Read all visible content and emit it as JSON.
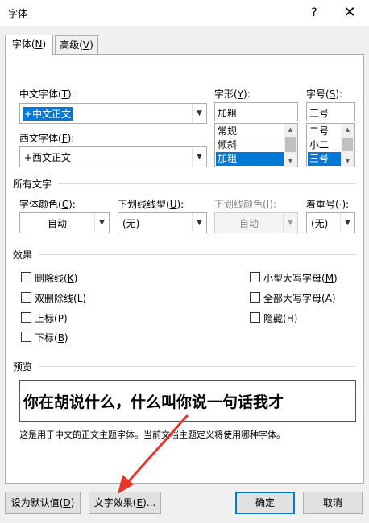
{
  "window": {
    "title": "字体",
    "help": "?",
    "close": "✕"
  },
  "tabs": [
    {
      "label": "字体(",
      "key": "N",
      "end": ")"
    },
    {
      "label": "高级(",
      "key": "V",
      "end": ")"
    }
  ],
  "chinese_font": {
    "label": "中文字体(",
    "key": "T",
    "end": "):",
    "value": "+中文正文"
  },
  "western_font": {
    "label": "西文字体(",
    "key": "F",
    "end": "):",
    "value": "+西文正文"
  },
  "font_style": {
    "label": "字形(",
    "key": "Y",
    "end": "):",
    "value": "加粗",
    "options": [
      "常规",
      "倾斜",
      "加粗"
    ],
    "selected_index": 2
  },
  "font_size": {
    "label": "字号(",
    "key": "S",
    "end": "):",
    "value": "三号",
    "options": [
      "二号",
      "小二",
      "三号"
    ],
    "selected_index": 2
  },
  "all_text": {
    "heading": "所有文字",
    "font_color": {
      "label": "字体颜色(",
      "key": "C",
      "end": "):",
      "value": "自动"
    },
    "underline_style": {
      "label": "下划线线型(",
      "key": "U",
      "end": "):",
      "value": "(无)"
    },
    "underline_color": {
      "label": "下划线颜色(I):",
      "value": "自动"
    },
    "emphasis": {
      "label": "着重号(·):",
      "value": "(无)"
    }
  },
  "effects": {
    "heading": "效果",
    "left": [
      {
        "label": "删除线(",
        "key": "K",
        "end": ")",
        "checked": false
      },
      {
        "label": "双删除线(",
        "key": "L",
        "end": ")",
        "checked": false
      },
      {
        "label": "上标(",
        "key": "P",
        "end": ")",
        "checked": false
      },
      {
        "label": "下标(",
        "key": "B",
        "end": ")",
        "checked": false
      }
    ],
    "right": [
      {
        "label": "小型大写字母(",
        "key": "M",
        "end": ")",
        "checked": false
      },
      {
        "label": "全部大写字母(",
        "key": "A",
        "end": ")",
        "checked": false
      },
      {
        "label": "隐藏(",
        "key": "H",
        "end": ")",
        "checked": false
      }
    ]
  },
  "preview": {
    "heading": "预览",
    "text": "你在胡说什么，什么叫你说一句话我才",
    "note": "这是用于中文的正文主题字体。当前文档主题定义将使用哪种字体。"
  },
  "buttons": {
    "set_default": {
      "label": "设为默认值(",
      "key": "D",
      "end": ")"
    },
    "text_effects": {
      "label": "文字效果(",
      "key": "E",
      "end": ")..."
    },
    "ok": "确定",
    "cancel": "取消"
  },
  "colors": {
    "accent": "#0078d7",
    "annotation_arrow": "#e8352b"
  }
}
